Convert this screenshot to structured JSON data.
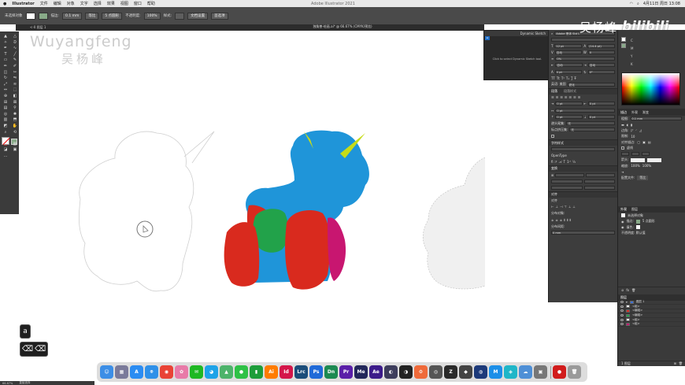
{
  "menubar": {
    "app": "Illustrator",
    "items": [
      "文件",
      "编辑",
      "对象",
      "文字",
      "选择",
      "效果",
      "视图",
      "窗口",
      "帮助"
    ],
    "window_title": "Adobe Illustrator 2021",
    "clock": "4月11日 周日 13:08"
  },
  "control_bar": {
    "mode": "未选择对象",
    "stroke_label": "描边:",
    "stroke_weight": "0.1 mm",
    "profile": "等比",
    "brush": "5 点圆形",
    "opacity_label": "不透明度:",
    "opacity": "100%",
    "style_label": "样式:",
    "doc_setup": "文档设置",
    "prefs": "首选项"
  },
  "document": {
    "title": "独角兽-绘画.ai* @ 66.67% (CMYK/预览)",
    "tab_label": "<-0 图层 1"
  },
  "watermark": {
    "latin": "Wuyangfeng",
    "chinese": "吴杨峰"
  },
  "brand": {
    "name": "吴杨峰",
    "logo": "bilibili"
  },
  "dynamic_sketch": {
    "title": "Dynamic Sketch",
    "tab": "ai",
    "message": "Click to select Dynamic Sketch tool."
  },
  "properties": {
    "font_family": "Adobe 黑体 Std L",
    "font_size": "12 pt",
    "leading": "(14.4 pt)",
    "tracking_mode": "自动",
    "tracking": "0",
    "scale": "0%",
    "baseline": "0 pt",
    "rotation": "0°",
    "auto_label": "自动",
    "lang_label": "英语: 美国",
    "lang_value": "锐化",
    "paragraph_label": "段落",
    "align_label": "对齐",
    "indent_values": [
      "0 pt",
      "0 pt",
      "0 pt",
      "0 pt",
      "0 pt"
    ],
    "hyphenation_label": "避头尾集:",
    "hyphenation_value": "无",
    "punctuation_label": "标点挤压集:",
    "punctuation_value": "无",
    "char_label": "字符样式",
    "para_style": "段落样式",
    "opentype": "OpenType",
    "transform_label": "变换",
    "align_section": "对齐",
    "distribute_label": "分布对象:",
    "spacing_label": "分布间距:",
    "spacing_value": "0 mm"
  },
  "color_panel": {
    "tabs": [
      "颜色",
      "色板",
      "颜色参考"
    ],
    "channels": [
      "C",
      "M",
      "Y",
      "K"
    ]
  },
  "appearance_panel": {
    "tabs": [
      "描边",
      "外观",
      "渐变"
    ],
    "weight_label": "粗细:",
    "weight": "0.1 mm",
    "corner_label": "边角:",
    "limit_label": "限制:",
    "limit": "10",
    "align_stroke_label": "对齐描边:",
    "dashed_label": "虚线",
    "arrow_label": "箭头:",
    "scale_label": "缩放:",
    "scale_values": [
      "100%",
      "100%"
    ],
    "profile_label": "配置文件:",
    "profile_value": "等比"
  },
  "layers_panel": {
    "tabs": [
      "外观",
      "图层"
    ],
    "object_label": "未选择对象",
    "stroke_label": "描边:",
    "stroke_value": "5 点圆形",
    "fill_label": "填色:",
    "opacity_label": "不透明度: 默认值",
    "layer_rows": [
      {
        "name": "图层 1",
        "color": "#3a6fd6"
      },
      {
        "name": "<组>",
        "color": "#ffffff"
      },
      {
        "name": "<编组>",
        "color": "#d92a1e"
      },
      {
        "name": "<编组>",
        "color": "#22a24a"
      },
      {
        "name": "<组>",
        "color": "#ffffff"
      },
      {
        "name": "<组>",
        "color": "#c81670"
      }
    ],
    "footer": "1 图层"
  },
  "keystrokes": {
    "key_a": "a",
    "key_delete": "⌫"
  },
  "dock_apps": [
    {
      "name": "Finder",
      "label": "☺",
      "color": "#3c8ee6"
    },
    {
      "name": "Launchpad",
      "label": "▦",
      "color": "#7a7a9a"
    },
    {
      "name": "App Store",
      "label": "A",
      "color": "#2b8cf2"
    },
    {
      "name": "Safari",
      "label": "⌾",
      "color": "#2f90e8"
    },
    {
      "name": "Chrome",
      "label": "◉",
      "color": "#e94235"
    },
    {
      "name": "Photos",
      "label": "✿",
      "color": "#e87aa8"
    },
    {
      "name": "WeChat",
      "label": "✉",
      "color": "#1fb823"
    },
    {
      "name": "QQ",
      "label": "◕",
      "color": "#1ea3e8"
    },
    {
      "name": "Maps",
      "label": "▲",
      "color": "#4db36a"
    },
    {
      "name": "Messages",
      "label": "●",
      "color": "#2ec146"
    },
    {
      "name": "Numbers",
      "label": "▮",
      "color": "#1d9d3a"
    },
    {
      "name": "Illustrator",
      "label": "Ai",
      "color": "#ff7c00"
    },
    {
      "name": "InDesign",
      "label": "Id",
      "color": "#d4164a"
    },
    {
      "name": "Lightroom Classic",
      "label": "Lrc",
      "color": "#1b4d7a"
    },
    {
      "name": "Photoshop",
      "label": "Ps",
      "color": "#1f6ad8"
    },
    {
      "name": "Dimension",
      "label": "Dn",
      "color": "#1c8a52"
    },
    {
      "name": "Premiere Pro",
      "label": "Pr",
      "color": "#5a1fa8"
    },
    {
      "name": "Media Encoder",
      "label": "Me",
      "color": "#22275a"
    },
    {
      "name": "After Effects",
      "label": "Ae",
      "color": "#3c1b8a"
    },
    {
      "name": "App 20",
      "label": "◐",
      "color": "#3d3d5c"
    },
    {
      "name": "App 21",
      "label": "◑",
      "color": "#222222"
    },
    {
      "name": "App 22",
      "label": "⚙",
      "color": "#ef6a3a"
    },
    {
      "name": "App 23",
      "label": "◎",
      "color": "#555555"
    },
    {
      "name": "ZBrush",
      "label": "Z",
      "color": "#2a2a2a"
    },
    {
      "name": "App 25",
      "label": "◆",
      "color": "#444444"
    },
    {
      "name": "Cinema 4D",
      "label": "◍",
      "color": "#1d3a7a"
    },
    {
      "name": "Mail",
      "label": "M",
      "color": "#1c8fe8"
    },
    {
      "name": "App 28",
      "label": "◈",
      "color": "#1fb6c8"
    },
    {
      "name": "App 29",
      "label": "☁",
      "color": "#4e8fd6"
    },
    {
      "name": "App 30",
      "label": "▣",
      "color": "#777777"
    },
    {
      "name": "Recorder",
      "label": "●",
      "color": "#d11c1c"
    },
    {
      "name": "Trash",
      "label": "🗑",
      "color": "#9a9a9a"
    }
  ],
  "statusbar": {
    "zoom": "66.67%",
    "mode": "直接选择"
  },
  "colors": {
    "unicorn_body": "#1f95d9",
    "unicorn_red": "#d92a1e",
    "unicorn_green": "#22a24a",
    "unicorn_magenta": "#c81670",
    "unicorn_horn": "#c6dc18",
    "panel_bg": "#3d3d3d"
  }
}
